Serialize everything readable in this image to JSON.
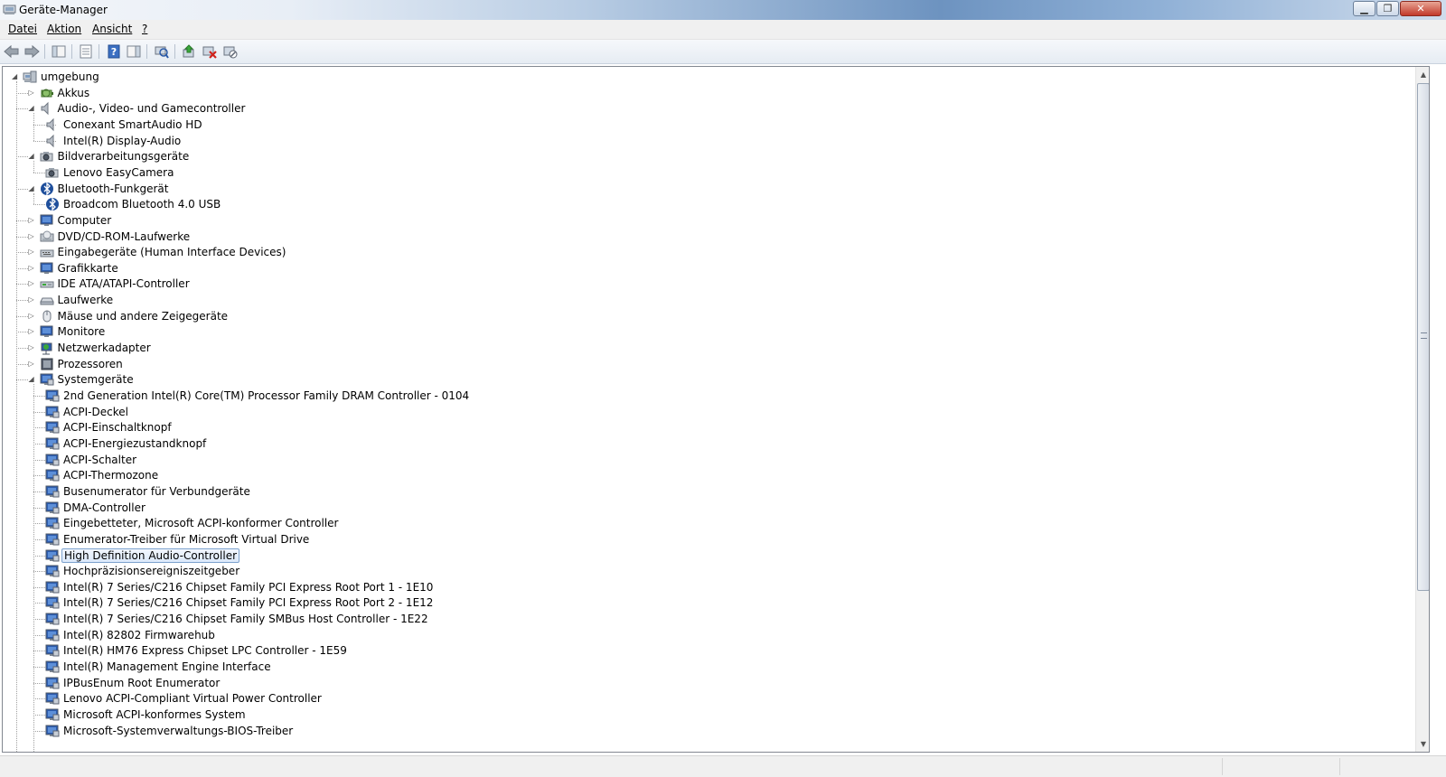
{
  "window": {
    "title": "Geräte-Manager"
  },
  "menu": {
    "items": [
      "Datei",
      "Aktion",
      "Ansicht",
      "?"
    ]
  },
  "toolbar": {
    "buttons": [
      "back-arrow-icon",
      "forward-arrow-icon",
      "show-hide-console-tree-icon",
      "properties-icon",
      "help-icon",
      "action-pane-icon",
      "scan-hardware-icon",
      "update-driver-icon",
      "uninstall-device-icon",
      "disable-device-icon"
    ]
  },
  "tree": {
    "root": "umgebung",
    "nodes": [
      {
        "label": "umgebung",
        "level": 0,
        "expander": "open",
        "icon": "computer-icon"
      },
      {
        "label": "Akkus",
        "level": 1,
        "expander": "closed",
        "icon": "battery-icon"
      },
      {
        "label": "Audio-, Video- und Gamecontroller",
        "level": 1,
        "expander": "open",
        "icon": "speaker-icon"
      },
      {
        "label": "Conexant SmartAudio HD",
        "level": 2,
        "expander": "none",
        "icon": "speaker-icon"
      },
      {
        "label": "Intel(R) Display-Audio",
        "level": 2,
        "expander": "none",
        "icon": "speaker-icon"
      },
      {
        "label": "Bildverarbeitungsgeräte",
        "level": 1,
        "expander": "open",
        "icon": "camera-icon"
      },
      {
        "label": "Lenovo EasyCamera",
        "level": 2,
        "expander": "none",
        "icon": "camera-icon"
      },
      {
        "label": "Bluetooth-Funkgerät",
        "level": 1,
        "expander": "open",
        "icon": "bluetooth-icon"
      },
      {
        "label": "Broadcom Bluetooth 4.0 USB",
        "level": 2,
        "expander": "none",
        "icon": "bluetooth-icon"
      },
      {
        "label": "Computer",
        "level": 1,
        "expander": "closed",
        "icon": "monitor-icon"
      },
      {
        "label": "DVD/CD-ROM-Laufwerke",
        "level": 1,
        "expander": "closed",
        "icon": "disc-drive-icon"
      },
      {
        "label": "Eingabegeräte (Human Interface Devices)",
        "level": 1,
        "expander": "closed",
        "icon": "hid-icon"
      },
      {
        "label": "Grafikkarte",
        "level": 1,
        "expander": "closed",
        "icon": "monitor-icon"
      },
      {
        "label": "IDE ATA/ATAPI-Controller",
        "level": 1,
        "expander": "closed",
        "icon": "drive-controller-icon"
      },
      {
        "label": "Laufwerke",
        "level": 1,
        "expander": "closed",
        "icon": "drive-icon"
      },
      {
        "label": "Mäuse und andere Zeigegeräte",
        "level": 1,
        "expander": "closed",
        "icon": "mouse-icon"
      },
      {
        "label": "Monitore",
        "level": 1,
        "expander": "closed",
        "icon": "monitor-icon"
      },
      {
        "label": "Netzwerkadapter",
        "level": 1,
        "expander": "closed",
        "icon": "network-icon"
      },
      {
        "label": "Prozessoren",
        "level": 1,
        "expander": "closed",
        "icon": "processor-icon"
      },
      {
        "label": "Systemgeräte",
        "level": 1,
        "expander": "open",
        "icon": "system-device-icon"
      },
      {
        "label": "2nd Generation Intel(R) Core(TM) Processor Family DRAM Controller - 0104",
        "level": 2,
        "expander": "none",
        "icon": "system-device-icon"
      },
      {
        "label": "ACPI-Deckel",
        "level": 2,
        "expander": "none",
        "icon": "system-device-icon"
      },
      {
        "label": "ACPI-Einschaltknopf",
        "level": 2,
        "expander": "none",
        "icon": "system-device-icon"
      },
      {
        "label": "ACPI-Energiezustandknopf",
        "level": 2,
        "expander": "none",
        "icon": "system-device-icon"
      },
      {
        "label": "ACPI-Schalter",
        "level": 2,
        "expander": "none",
        "icon": "system-device-icon"
      },
      {
        "label": "ACPI-Thermozone",
        "level": 2,
        "expander": "none",
        "icon": "system-device-icon"
      },
      {
        "label": "Busenumerator für Verbundgeräte",
        "level": 2,
        "expander": "none",
        "icon": "system-device-icon"
      },
      {
        "label": "DMA-Controller",
        "level": 2,
        "expander": "none",
        "icon": "system-device-icon"
      },
      {
        "label": "Eingebetteter, Microsoft ACPI-konformer Controller",
        "level": 2,
        "expander": "none",
        "icon": "system-device-icon"
      },
      {
        "label": "Enumerator-Treiber für Microsoft Virtual Drive",
        "level": 2,
        "expander": "none",
        "icon": "system-device-icon"
      },
      {
        "label": "High Definition Audio-Controller",
        "level": 2,
        "expander": "none",
        "icon": "system-device-icon",
        "selected": true
      },
      {
        "label": "Hochpräzisionsereigniszeitgeber",
        "level": 2,
        "expander": "none",
        "icon": "system-device-icon"
      },
      {
        "label": "Intel(R) 7 Series/C216 Chipset Family PCI Express Root Port 1 - 1E10",
        "level": 2,
        "expander": "none",
        "icon": "system-device-icon"
      },
      {
        "label": "Intel(R) 7 Series/C216 Chipset Family PCI Express Root Port 2 - 1E12",
        "level": 2,
        "expander": "none",
        "icon": "system-device-icon"
      },
      {
        "label": "Intel(R) 7 Series/C216 Chipset Family SMBus Host Controller - 1E22",
        "level": 2,
        "expander": "none",
        "icon": "system-device-icon"
      },
      {
        "label": "Intel(R) 82802 Firmwarehub",
        "level": 2,
        "expander": "none",
        "icon": "system-device-icon"
      },
      {
        "label": "Intel(R) HM76 Express Chipset LPC Controller - 1E59",
        "level": 2,
        "expander": "none",
        "icon": "system-device-icon"
      },
      {
        "label": "Intel(R) Management Engine Interface",
        "level": 2,
        "expander": "none",
        "icon": "system-device-icon"
      },
      {
        "label": "IPBusEnum Root Enumerator",
        "level": 2,
        "expander": "none",
        "icon": "system-device-icon"
      },
      {
        "label": "Lenovo ACPI-Compliant Virtual Power Controller",
        "level": 2,
        "expander": "none",
        "icon": "system-device-icon"
      },
      {
        "label": "Microsoft ACPI-konformes System",
        "level": 2,
        "expander": "none",
        "icon": "system-device-icon"
      },
      {
        "label": "Microsoft-Systemverwaltungs-BIOS-Treiber",
        "level": 2,
        "expander": "none",
        "icon": "system-device-icon"
      }
    ]
  },
  "colors": {
    "selection_border": "#7da2ce",
    "selection_fill": "#dbe8fa",
    "title_blue": "#6d93c0",
    "close_red": "#c2392a"
  }
}
